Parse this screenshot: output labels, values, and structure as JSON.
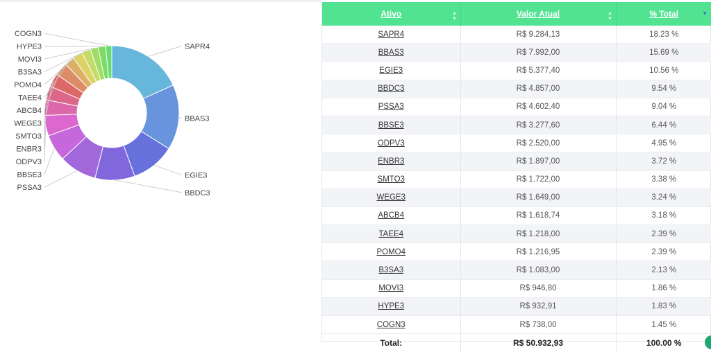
{
  "chart_data": {
    "type": "pie",
    "categories": [
      "SAPR4",
      "BBAS3",
      "EGIE3",
      "BBDC3",
      "PSSA3",
      "BBSE3",
      "ODPV3",
      "ENBR3",
      "SMTO3",
      "WEGE3",
      "ABCB4",
      "TAEE4",
      "POMO4",
      "B3SA3",
      "MOVI3",
      "HYPE3",
      "COGN3"
    ],
    "values": [
      18.23,
      15.69,
      10.56,
      9.54,
      9.04,
      6.44,
      4.95,
      3.72,
      3.38,
      3.24,
      3.18,
      2.39,
      2.39,
      2.13,
      1.86,
      1.83,
      1.45
    ],
    "colors": [
      "#67b7dc",
      "#6794dc",
      "#6771dc",
      "#8067dc",
      "#a367dc",
      "#c767dc",
      "#dc67ce",
      "#dc67ab",
      "#dc6788",
      "#dc6967",
      "#dc8c67",
      "#dcaf67",
      "#dcd267",
      "#c3dc67",
      "#a0dc67",
      "#7ddc67",
      "#67dc75"
    ]
  },
  "table": {
    "headers": {
      "ativo": "Ativo",
      "valor": "Valor Atual",
      "pct": "% Total"
    },
    "rows": [
      {
        "ticker": "SAPR4",
        "valor": "R$ 9.284,13",
        "pct": "18.23 %"
      },
      {
        "ticker": "BBAS3",
        "valor": "R$ 7.992,00",
        "pct": "15.69 %"
      },
      {
        "ticker": "EGIE3",
        "valor": "R$ 5.377,40",
        "pct": "10.56 %"
      },
      {
        "ticker": "BBDC3",
        "valor": "R$ 4.857,00",
        "pct": "9.54 %"
      },
      {
        "ticker": "PSSA3",
        "valor": "R$ 4.602,40",
        "pct": "9.04 %"
      },
      {
        "ticker": "BBSE3",
        "valor": "R$ 3.277,60",
        "pct": "6.44 %"
      },
      {
        "ticker": "ODPV3",
        "valor": "R$ 2.520,00",
        "pct": "4.95 %"
      },
      {
        "ticker": "ENBR3",
        "valor": "R$ 1.897,00",
        "pct": "3.72 %"
      },
      {
        "ticker": "SMTO3",
        "valor": "R$ 1.722,00",
        "pct": "3.38 %"
      },
      {
        "ticker": "WEGE3",
        "valor": "R$ 1.649,00",
        "pct": "3.24 %"
      },
      {
        "ticker": "ABCB4",
        "valor": "R$ 1.618,74",
        "pct": "3.18 %"
      },
      {
        "ticker": "TAEE4",
        "valor": "R$ 1.218,00",
        "pct": "2.39 %"
      },
      {
        "ticker": "POMO4",
        "valor": "R$ 1.216,95",
        "pct": "2.39 %"
      },
      {
        "ticker": "B3SA3",
        "valor": "R$ 1.083,00",
        "pct": "2.13 %"
      },
      {
        "ticker": "MOVI3",
        "valor": "R$ 946,80",
        "pct": "1.86 %"
      },
      {
        "ticker": "HYPE3",
        "valor": "R$ 932,91",
        "pct": "1.83 %"
      },
      {
        "ticker": "COGN3",
        "valor": "R$ 738,00",
        "pct": "1.45 %"
      }
    ],
    "footer": {
      "label": "Total:",
      "valor": "R$ 50.932,93",
      "pct": "100.00 %"
    }
  },
  "icons": {
    "sort": "sort-both-icon",
    "sort_active": "sort-desc-icon"
  },
  "accent": "#52e391"
}
